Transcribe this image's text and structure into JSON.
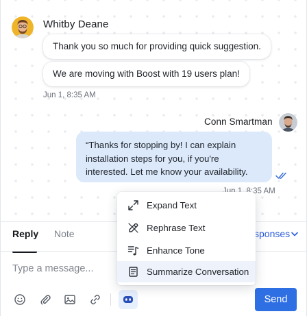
{
  "conversation": {
    "incoming": {
      "sender": "Whitby Deane",
      "messages": [
        "Thank you so much for providing quick suggestion.",
        "We are moving with Boost with 19 users plan!"
      ],
      "timestamp": "Jun 1, 8:35 AM"
    },
    "outgoing": {
      "sender": "Conn Smartman",
      "message": "“Thanks for stopping by! I can explain installation steps for you, if you're interested. Let me know your availability.",
      "timestamp": "Jun 1, 8:35 AM",
      "status_icon": "double-check-icon"
    }
  },
  "composer": {
    "tabs": [
      {
        "label": "Reply",
        "active": true
      },
      {
        "label": "Note",
        "active": false
      }
    ],
    "responses_label": "sponses",
    "placeholder": "Type a message...",
    "tools": [
      "emoji-icon",
      "attachment-icon",
      "image-icon",
      "link-icon",
      "ai-assist-icon"
    ],
    "send_label": "Send"
  },
  "ai_menu": {
    "items": [
      {
        "label": "Expand Text",
        "icon": "expand-icon"
      },
      {
        "label": "Rephrase Text",
        "icon": "rephrase-icon"
      },
      {
        "label": "Enhance Tone",
        "icon": "tone-icon"
      },
      {
        "label": "Summarize Conversation",
        "icon": "summarize-icon",
        "highlighted": true
      }
    ]
  },
  "colors": {
    "accent": "#2f6fe4",
    "outgoing_bubble": "#dbe9fb",
    "menu_highlight": "#eef3fb"
  }
}
